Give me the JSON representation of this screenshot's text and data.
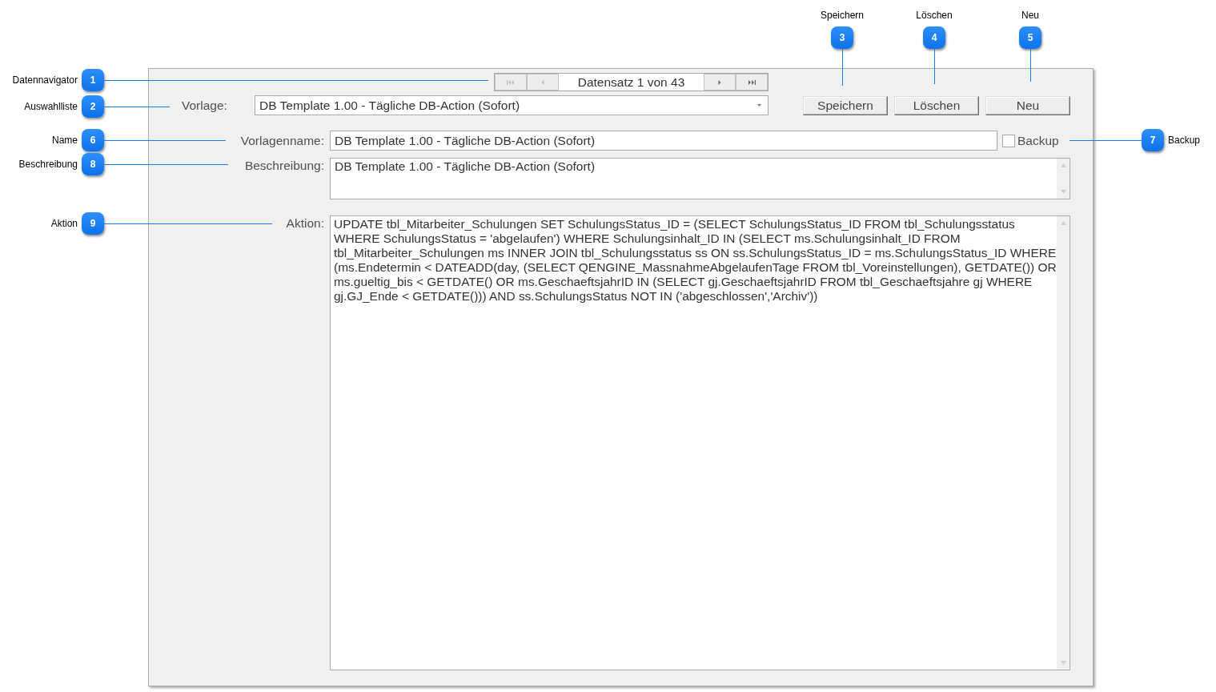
{
  "callouts": [
    {
      "kind": "top",
      "number": "3",
      "label": "Speichern"
    },
    {
      "kind": "top",
      "number": "4",
      "label": "Löschen"
    },
    {
      "kind": "top",
      "number": "5",
      "label": "Neu"
    },
    {
      "kind": "left",
      "number": "1",
      "label": "Datennavigator"
    },
    {
      "kind": "left",
      "number": "2",
      "label": "Auswahlliste"
    },
    {
      "kind": "left",
      "number": "6",
      "label": "Name"
    },
    {
      "kind": "right",
      "number": "7",
      "label": "Backup"
    },
    {
      "kind": "left",
      "number": "8",
      "label": "Beschreibung"
    },
    {
      "kind": "left",
      "number": "9",
      "label": "Aktion"
    }
  ],
  "form": {
    "navigator": {
      "back_buttons": [
        {
          "kind": "first",
          "disabled": true
        },
        {
          "kind": "previous",
          "disabled": true
        }
      ],
      "record": "Datensatz 1 von 43",
      "forward_buttons": [
        {
          "kind": "next",
          "disabled": false
        },
        {
          "kind": "last",
          "disabled": false
        }
      ]
    },
    "template_select": {
      "label": "Vorlage:",
      "value": "DB Template 1.00 - Tägliche DB-Action (Sofort)"
    },
    "buttons": [
      "Speichern",
      "Löschen",
      "Neu"
    ],
    "name_field": {
      "label": "Vorlagenname:",
      "value": "DB Template 1.00 - Tägliche DB-Action (Sofort)"
    },
    "backup": {
      "label": "Backup",
      "checked": false
    },
    "description": {
      "label": "Beschreibung:",
      "value": "DB Template 1.00 - Tägliche DB-Action (Sofort)"
    },
    "action": {
      "label": "Aktion:",
      "value": "UPDATE tbl_Mitarbeiter_Schulungen SET SchulungsStatus_ID = (SELECT SchulungsStatus_ID FROM tbl_Schulungsstatus WHERE SchulungsStatus = 'abgelaufen') WHERE Schulungsinhalt_ID IN (SELECT ms.Schulungsinhalt_ID FROM tbl_Mitarbeiter_Schulungen ms INNER JOIN tbl_Schulungsstatus ss ON ss.SchulungsStatus_ID = ms.SchulungsStatus_ID WHERE (ms.Endetermin < DATEADD(day, (SELECT QENGINE_MassnahmeAbgelaufenTage FROM tbl_Voreinstellungen), GETDATE()) OR ms.gueltig_bis < GETDATE() OR ms.GeschaeftsjahrID IN (SELECT gj.GeschaeftsjahrID FROM tbl_Geschaeftsjahre gj WHERE gj.GJ_Ende < GETDATE())) AND ss.SchulungsStatus NOT IN ('abgeschlossen','Archiv'))"
    }
  }
}
